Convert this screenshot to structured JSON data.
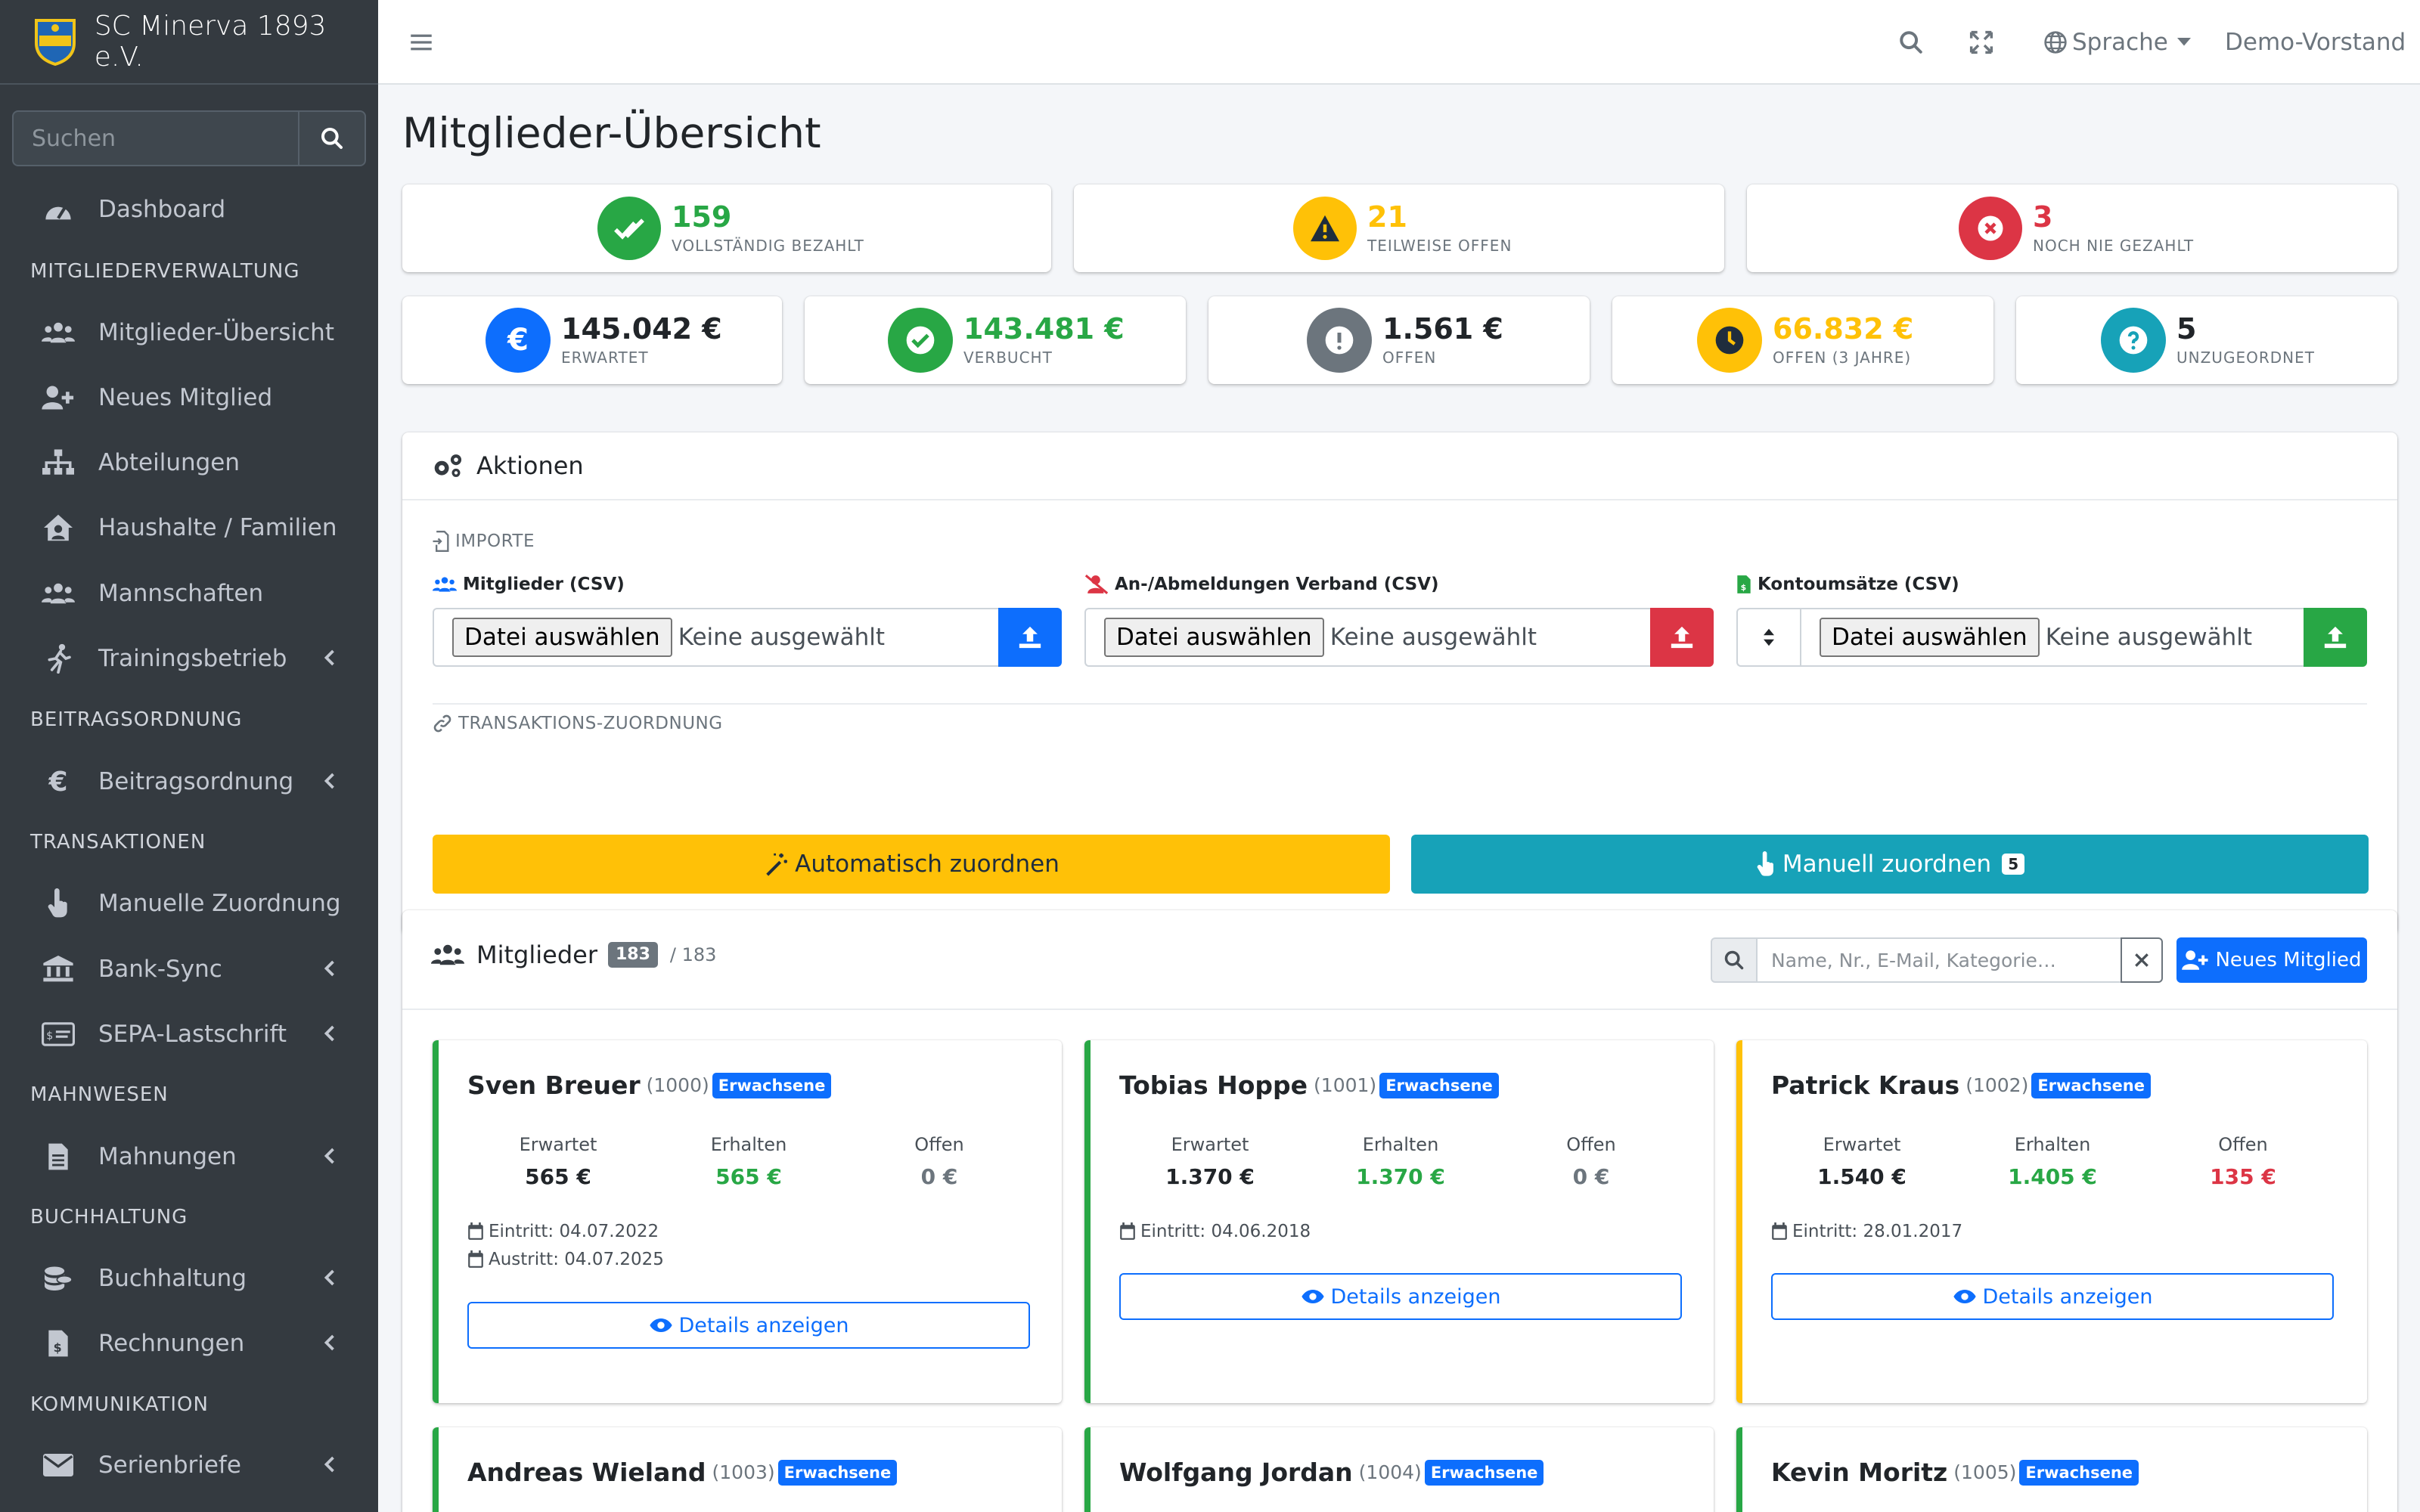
{
  "brand": {
    "name": "SC Minerva 1893 e.V."
  },
  "sidebar": {
    "search_placeholder": "Suchen",
    "dashboard": "Dashboard",
    "section_members": "MITGLIEDERVERWALTUNG",
    "members_overview": "Mitglieder-Übersicht",
    "new_member": "Neues Mitglied",
    "departments": "Abteilungen",
    "households": "Haushalte / Familien",
    "teams": "Mannschaften",
    "training": "Trainingsbetrieb",
    "section_fees": "BEITRAGSORDNUNG",
    "fees": "Beitragsordnung",
    "section_transactions": "TRANSAKTIONEN",
    "manual_assignment": "Manuelle Zuordnung",
    "bank_sync": "Bank-Sync",
    "sepa": "SEPA-Lastschrift",
    "section_dunning": "MAHNWESEN",
    "dunning": "Mahnungen",
    "section_accounting": "BUCHHALTUNG",
    "accounting": "Buchhaltung",
    "invoices": "Rechnungen",
    "section_communication": "KOMMUNIKATION",
    "serial_letters": "Serienbriefe"
  },
  "topbar": {
    "language": "Sprache",
    "user": "Demo-Vorstand"
  },
  "page": {
    "title": "Mitglieder-Übersicht"
  },
  "stats_top": {
    "paid": {
      "value": "159",
      "label": "VOLLSTÄNDIG BEZAHLT"
    },
    "partial": {
      "value": "21",
      "label": "TEILWEISE OFFEN"
    },
    "never": {
      "value": "3",
      "label": "NOCH NIE GEZAHLT"
    }
  },
  "stats_money": {
    "expected": {
      "value": "145.042 €",
      "label": "ERWARTET"
    },
    "booked": {
      "value": "143.481 €",
      "label": "VERBUCHT"
    },
    "open": {
      "value": "1.561 €",
      "label": "OFFEN"
    },
    "open3": {
      "value": "66.832 €",
      "label": "OFFEN (3 JAHRE)"
    },
    "unassigned": {
      "value": "5",
      "label": "UNZUGEORDNET"
    }
  },
  "actions": {
    "title": "Aktionen",
    "imports_label": "IMPORTE",
    "members_csv": "Mitglieder (CSV)",
    "federation_csv": "An-/Abmeldungen Verband (CSV)",
    "account_csv": "Kontoumsätze (CSV)",
    "choose_file": "Datei auswählen",
    "none_selected": "Keine ausgewählt",
    "tx_label": "TRANSAKTIONS-ZUORDNUNG",
    "auto_assign": "Automatisch zuordnen",
    "manual_assign": "Manuell zuordnen",
    "manual_count": "5"
  },
  "members": {
    "title": "Mitglieder",
    "count": "183",
    "total": "/ 183",
    "search_placeholder": "Name, Nr., E-Mail, Kategorie…",
    "new_button": "Neues Mitglied",
    "col_expected": "Erwartet",
    "col_received": "Erhalten",
    "col_open": "Offen",
    "details": "Details anzeigen",
    "list": [
      {
        "name": "Sven Breuer",
        "nr": "(1000)",
        "category": "Erwachsene",
        "expected": "565 €",
        "received": "565 €",
        "open": "0 €",
        "entry": "Eintritt: 04.07.2022",
        "exit": "Austritt: 04.07.2025"
      },
      {
        "name": "Tobias Hoppe",
        "nr": "(1001)",
        "category": "Erwachsene",
        "expected": "1.370 €",
        "received": "1.370 €",
        "open": "0 €",
        "entry": "Eintritt: 04.06.2018"
      },
      {
        "name": "Patrick Kraus",
        "nr": "(1002)",
        "category": "Erwachsene",
        "expected": "1.540 €",
        "received": "1.405 €",
        "open": "135 €",
        "entry": "Eintritt: 28.01.2017"
      },
      {
        "name": "Andreas Wieland",
        "nr": "(1003)",
        "category": "Erwachsene"
      },
      {
        "name": "Wolfgang Jordan",
        "nr": "(1004)",
        "category": "Erwachsene"
      },
      {
        "name": "Kevin Moritz",
        "nr": "(1005)",
        "category": "Erwachsene"
      }
    ]
  },
  "colors": {
    "success": "#28a745",
    "warning": "#ffc107",
    "danger": "#dc3545",
    "primary": "#0d6efd",
    "info": "#17a2b8",
    "secondary": "#6c757d",
    "sidebar": "#343a40"
  }
}
